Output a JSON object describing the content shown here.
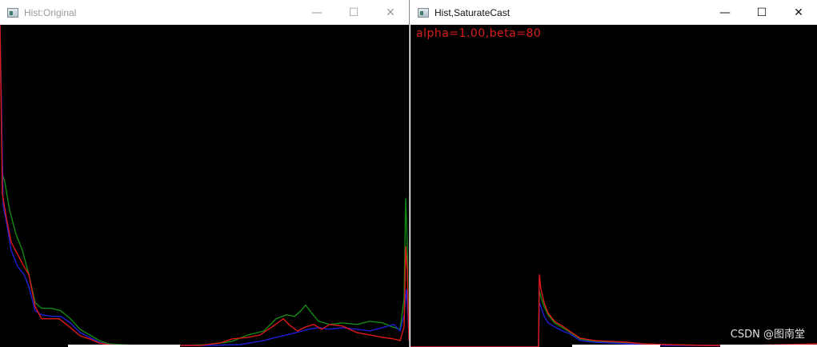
{
  "windows": [
    {
      "title": "Hist:Original",
      "controls": {
        "minimize": "—",
        "maximize": "☐",
        "close": "✕"
      }
    },
    {
      "title": "Hist,SaturateCast",
      "controls": {
        "minimize": "—",
        "maximize": "☐",
        "close": "✕"
      },
      "overlay_text": "alpha=1.00,beta=80"
    }
  ],
  "watermark": "CSDN @图南堂",
  "colors": {
    "blue": "#1f1fd6",
    "green": "#128a12",
    "red": "#e01818"
  },
  "chart_data": [
    {
      "type": "line",
      "x_range": [
        0,
        255
      ],
      "ylim": [
        0,
        400
      ],
      "series": [
        {
          "color": "green",
          "values": [
            [
              0,
              400
            ],
            [
              3,
              215
            ],
            [
              6,
              205
            ],
            [
              12,
              170
            ],
            [
              20,
              140
            ],
            [
              28,
              120
            ],
            [
              36,
              90
            ],
            [
              44,
              55
            ],
            [
              52,
              48
            ],
            [
              64,
              48
            ],
            [
              76,
              45
            ],
            [
              88,
              35
            ],
            [
              100,
              22
            ],
            [
              112,
              15
            ],
            [
              124,
              8
            ],
            [
              136,
              4
            ],
            [
              150,
              3
            ],
            [
              170,
              2
            ],
            [
              200,
              2
            ],
            [
              230,
              2
            ],
            [
              260,
              3
            ],
            [
              290,
              7
            ],
            [
              310,
              15
            ],
            [
              330,
              20
            ],
            [
              345,
              35
            ],
            [
              358,
              40
            ],
            [
              368,
              38
            ],
            [
              376,
              45
            ],
            [
              382,
              52
            ],
            [
              388,
              44
            ],
            [
              398,
              32
            ],
            [
              412,
              28
            ],
            [
              428,
              30
            ],
            [
              446,
              28
            ],
            [
              462,
              32
            ],
            [
              478,
              30
            ],
            [
              490,
              25
            ],
            [
              500,
              22
            ],
            [
              505,
              60
            ],
            [
              507,
              185
            ],
            [
              509,
              125
            ],
            [
              511,
              20
            ]
          ]
        },
        {
          "color": "blue",
          "values": [
            [
              0,
              400
            ],
            [
              4,
              175
            ],
            [
              8,
              155
            ],
            [
              14,
              120
            ],
            [
              22,
              100
            ],
            [
              30,
              90
            ],
            [
              36,
              75
            ],
            [
              44,
              45
            ],
            [
              52,
              40
            ],
            [
              64,
              38
            ],
            [
              76,
              38
            ],
            [
              88,
              30
            ],
            [
              100,
              18
            ],
            [
              112,
              12
            ],
            [
              124,
              6
            ],
            [
              136,
              3
            ],
            [
              150,
              2
            ],
            [
              180,
              2
            ],
            [
              220,
              2
            ],
            [
              260,
              2
            ],
            [
              300,
              3
            ],
            [
              330,
              8
            ],
            [
              345,
              12
            ],
            [
              358,
              15
            ],
            [
              370,
              18
            ],
            [
              386,
              22
            ],
            [
              398,
              24
            ],
            [
              412,
              22
            ],
            [
              428,
              24
            ],
            [
              446,
              22
            ],
            [
              462,
              20
            ],
            [
              478,
              24
            ],
            [
              492,
              28
            ],
            [
              500,
              20
            ],
            [
              505,
              40
            ],
            [
              508,
              72
            ],
            [
              511,
              15
            ]
          ]
        },
        {
          "color": "red",
          "values": [
            [
              0,
              400
            ],
            [
              3,
              190
            ],
            [
              8,
              160
            ],
            [
              14,
              130
            ],
            [
              22,
              115
            ],
            [
              30,
              100
            ],
            [
              36,
              90
            ],
            [
              44,
              50
            ],
            [
              52,
              35
            ],
            [
              62,
              35
            ],
            [
              74,
              35
            ],
            [
              88,
              24
            ],
            [
              100,
              14
            ],
            [
              112,
              10
            ],
            [
              124,
              5
            ],
            [
              136,
              3
            ],
            [
              150,
              2
            ],
            [
              200,
              2
            ],
            [
              250,
              2
            ],
            [
              275,
              5
            ],
            [
              290,
              10
            ],
            [
              310,
              12
            ],
            [
              325,
              15
            ],
            [
              340,
              25
            ],
            [
              354,
              35
            ],
            [
              362,
              27
            ],
            [
              372,
              20
            ],
            [
              382,
              25
            ],
            [
              392,
              28
            ],
            [
              402,
              22
            ],
            [
              412,
              28
            ],
            [
              428,
              26
            ],
            [
              446,
              18
            ],
            [
              462,
              15
            ],
            [
              478,
              12
            ],
            [
              492,
              10
            ],
            [
              500,
              8
            ],
            [
              505,
              25
            ],
            [
              507,
              125
            ],
            [
              509,
              95
            ],
            [
              511,
              8
            ]
          ]
        }
      ]
    },
    {
      "type": "line",
      "x_range": [
        0,
        255
      ],
      "ylim": [
        0,
        400
      ],
      "series": [
        {
          "color": "green",
          "values": [
            [
              0,
              0
            ],
            [
              160,
              0
            ],
            [
              161,
              70
            ],
            [
              163,
              62
            ],
            [
              167,
              50
            ],
            [
              172,
              40
            ],
            [
              180,
              30
            ],
            [
              190,
              24
            ],
            [
              200,
              18
            ],
            [
              212,
              10
            ],
            [
              230,
              7
            ],
            [
              250,
              6
            ],
            [
              270,
              5
            ],
            [
              290,
              4
            ],
            [
              320,
              3
            ],
            [
              370,
              2
            ],
            [
              420,
              2
            ],
            [
              470,
              2
            ],
            [
              508,
              2
            ]
          ]
        },
        {
          "color": "blue",
          "values": [
            [
              0,
              0
            ],
            [
              160,
              0
            ],
            [
              161,
              55
            ],
            [
              163,
              50
            ],
            [
              167,
              38
            ],
            [
              172,
              30
            ],
            [
              180,
              25
            ],
            [
              190,
              20
            ],
            [
              200,
              16
            ],
            [
              212,
              8
            ],
            [
              230,
              6
            ],
            [
              250,
              5
            ],
            [
              270,
              4
            ],
            [
              290,
              3
            ],
            [
              320,
              2
            ],
            [
              370,
              2
            ],
            [
              420,
              1
            ],
            [
              470,
              1
            ],
            [
              508,
              1
            ]
          ]
        },
        {
          "color": "red",
          "values": [
            [
              0,
              0
            ],
            [
              160,
              0
            ],
            [
              161,
              90
            ],
            [
              163,
              72
            ],
            [
              167,
              55
            ],
            [
              172,
              42
            ],
            [
              180,
              32
            ],
            [
              190,
              26
            ],
            [
              200,
              19
            ],
            [
              212,
              11
            ],
            [
              230,
              8
            ],
            [
              250,
              7
            ],
            [
              270,
              6
            ],
            [
              290,
              4
            ],
            [
              320,
              3
            ],
            [
              370,
              2
            ],
            [
              420,
              2
            ],
            [
              470,
              3
            ],
            [
              508,
              4
            ]
          ]
        }
      ]
    }
  ]
}
